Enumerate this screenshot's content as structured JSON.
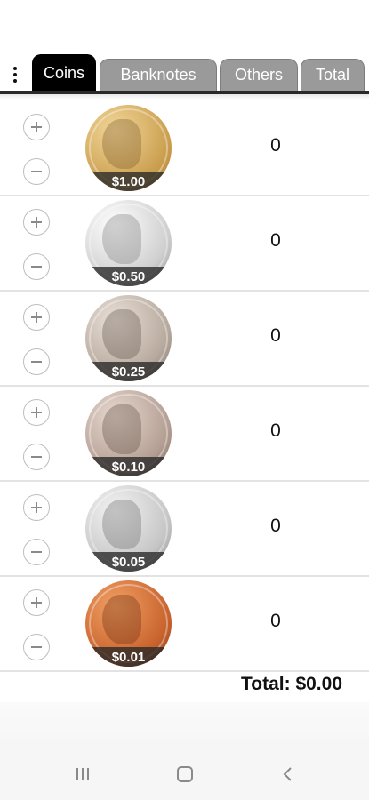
{
  "tabs": [
    {
      "label": "Coins",
      "active": true
    },
    {
      "label": "Banknotes",
      "active": false
    },
    {
      "label": "Others",
      "active": false
    },
    {
      "label": "Total",
      "active": false
    }
  ],
  "coins": [
    {
      "value_label": "$1.00",
      "count": "0",
      "coin_name": "dollar-coin-icon",
      "color": "#d8b366"
    },
    {
      "value_label": "$0.50",
      "count": "0",
      "coin_name": "half-dollar-coin-icon",
      "color": "#d7d7d7"
    },
    {
      "value_label": "$0.25",
      "count": "0",
      "coin_name": "quarter-coin-icon",
      "color": "#b8aba0"
    },
    {
      "value_label": "$0.10",
      "count": "0",
      "coin_name": "dime-coin-icon",
      "color": "#b69f94"
    },
    {
      "value_label": "$0.05",
      "count": "0",
      "coin_name": "nickel-coin-icon",
      "color": "#c9c9c9"
    },
    {
      "value_label": "$0.01",
      "count": "0",
      "coin_name": "penny-coin-icon",
      "color": "#c9632e"
    }
  ],
  "total_label": "Total: $0.00",
  "icons": {
    "menu": "more-vert-icon",
    "plus": "plus-icon",
    "minus": "minus-icon",
    "recents": "recents-icon",
    "home": "home-icon",
    "back": "back-icon"
  }
}
